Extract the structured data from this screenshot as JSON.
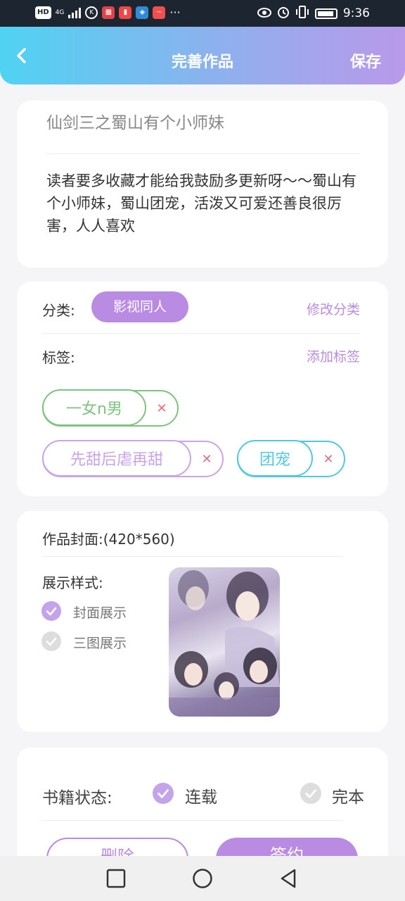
{
  "status_bar": {
    "network_label": "HD",
    "network_type": "4G",
    "time": "9:36",
    "app_icons": [
      "k-circle-icon",
      "calendar-icon",
      "book-red-icon",
      "app-blue-icon",
      "app-red-icon"
    ],
    "more": "···"
  },
  "header": {
    "title": "完善作品",
    "save_label": "保存",
    "gradient_start": "#4fd3f2",
    "gradient_end": "#b999ea"
  },
  "book": {
    "title": "仙剑三之蜀山有个小师妹",
    "description": "读者要多收藏才能给我鼓励多更新呀～～蜀山有个小师妹，蜀山团宠，活泼又可爱还善良很厉害，人人喜欢"
  },
  "category": {
    "label": "分类:",
    "value": "影视同人",
    "modify_label": "修改分类"
  },
  "tags": {
    "label": "标签:",
    "add_label": "添加标签",
    "items": [
      {
        "label": "一女n男",
        "color": "#7dc47f"
      },
      {
        "label": "先甜后虐再甜",
        "color": "#c9a3ec"
      },
      {
        "label": "团宠",
        "color": "#4fc9e3"
      }
    ],
    "remove_symbol": "✕"
  },
  "cover": {
    "label": "作品封面:",
    "size_hint": "(420*560)",
    "style_label": "展示样式:",
    "options": [
      {
        "label": "封面展示",
        "selected": true
      },
      {
        "label": "三图展示",
        "selected": false
      }
    ]
  },
  "status": {
    "label": "书籍状态:",
    "options": [
      {
        "label": "连载",
        "selected": true
      },
      {
        "label": "完本",
        "selected": false
      }
    ]
  },
  "actions": {
    "delete_label": "删除",
    "sign_label": "签约"
  },
  "colors": {
    "accent": "#b98be3",
    "unchecked": "#dddddd"
  }
}
